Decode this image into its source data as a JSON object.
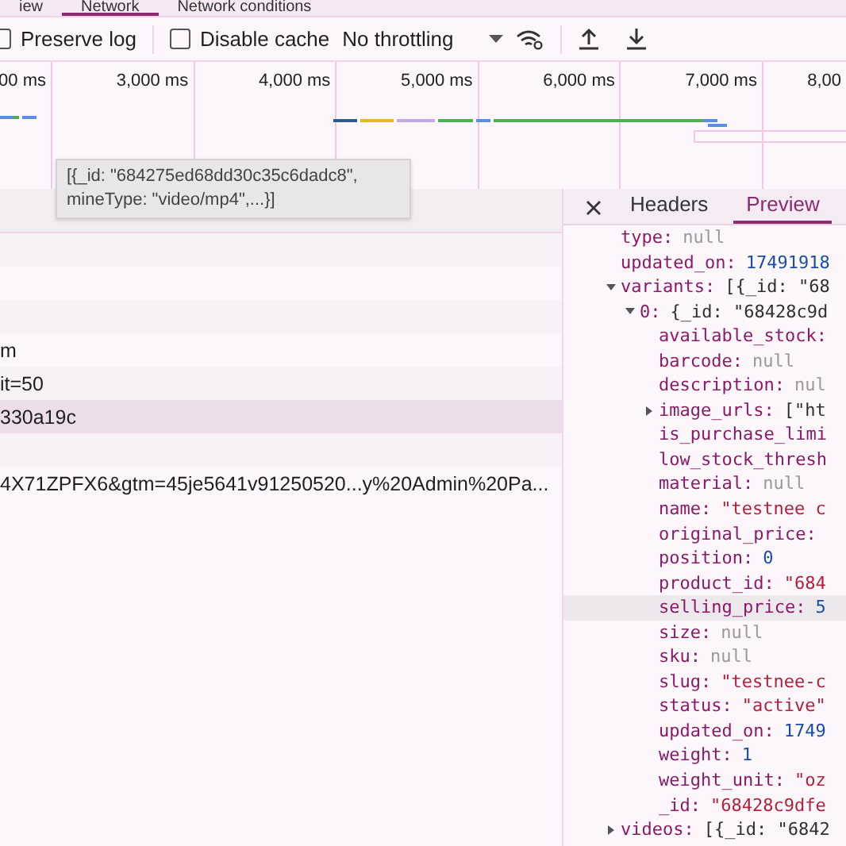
{
  "tabs": [
    {
      "label": "iew",
      "selected": false
    },
    {
      "label": "Network",
      "selected": true
    },
    {
      "label": "Network conditions",
      "selected": false
    }
  ],
  "toolbar": {
    "preserve_log": {
      "label": "Preserve log",
      "checked": false
    },
    "disable_cache": {
      "label": "Disable cache",
      "checked": false
    },
    "throttling": "No throttling"
  },
  "timeline": {
    "ticks": [
      "00 ms",
      "3,000 ms",
      "4,000 ms",
      "5,000 ms",
      "6,000 ms",
      "7,000 ms",
      "8,00"
    ]
  },
  "tooltip": "[{_id: \"684275ed68dd30c35c6dadc8\", mineType: \"video/mp4\",...}]",
  "requests": [
    {
      "selected": false
    },
    {
      "selected": false
    },
    {
      "selected": false
    },
    {
      "name": "m",
      "selected": false
    },
    {
      "name": "it=50",
      "selected": false
    },
    {
      "name": "330a19c",
      "selected": true
    },
    {
      "selected": false
    },
    {
      "name": "4X71ZPFX6&gtm=45je5641v91250520...y%20Admin%20Pa...",
      "selected": false
    }
  ],
  "details": {
    "tabs": [
      {
        "label": "Headers",
        "selected": false
      },
      {
        "label": "Preview",
        "selected": true
      }
    ],
    "preview": [
      {
        "key": "type:",
        "value": "null",
        "kind": "null"
      },
      {
        "key": "updated_on:",
        "value": "17491918",
        "kind": "number"
      },
      {
        "key": "variants:",
        "value": "[{_id: \"68",
        "kind": "preview",
        "expanded": true,
        "children": [
          {
            "key": "0:",
            "value": "{_id: \"68428c9d",
            "kind": "preview",
            "expanded": true,
            "children": [
              {
                "key": "available_stock:"
              },
              {
                "key": "barcode:",
                "value": "null",
                "kind": "null"
              },
              {
                "key": "description:",
                "value": "nul",
                "kind": "null"
              },
              {
                "key": "image_urls:",
                "value": "[\"ht",
                "kind": "preview",
                "expanded": false
              },
              {
                "key": "is_purchase_limi"
              },
              {
                "key": "low_stock_thresh"
              },
              {
                "key": "material:",
                "value": "null",
                "kind": "null"
              },
              {
                "key": "name:",
                "value": "\"testnee c",
                "kind": "string"
              },
              {
                "key": "original_price:"
              },
              {
                "key": "position:",
                "value": "0",
                "kind": "number"
              },
              {
                "key": "product_id:",
                "value": "\"684",
                "kind": "string"
              },
              {
                "key": "selling_price:",
                "value": "5",
                "kind": "number",
                "selected": true
              },
              {
                "key": "size:",
                "value": "null",
                "kind": "null"
              },
              {
                "key": "sku:",
                "value": "null",
                "kind": "null"
              },
              {
                "key": "slug:",
                "value": "\"testnee-c",
                "kind": "string"
              },
              {
                "key": "status:",
                "value": "\"active\"",
                "kind": "string"
              },
              {
                "key": "updated_on:",
                "value": "1749",
                "kind": "number"
              },
              {
                "key": "weight:",
                "value": "1",
                "kind": "number"
              },
              {
                "key": "weight_unit:",
                "value": "\"oz",
                "kind": "string"
              },
              {
                "key": "_id:",
                "value": "\"68428c9dfe",
                "kind": "string"
              }
            ]
          }
        ]
      },
      {
        "key": "videos:",
        "value": "[{_id: \"6842",
        "kind": "preview",
        "expanded": false
      }
    ]
  }
}
